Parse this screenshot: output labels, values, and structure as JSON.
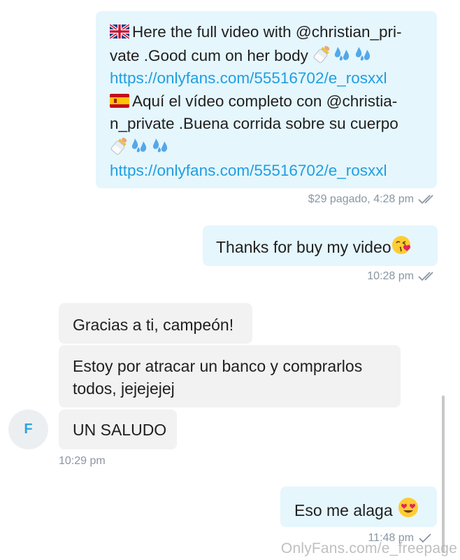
{
  "messages": {
    "m1": {
      "line1": "Here the full video with @christian_pri-",
      "line2": "vate .Good cum on her body",
      "line3": "https://onlyfans.com/55516702/e_rosxxl",
      "line4": "Aquí el vídeo completo con @christia-",
      "line5": "n_private .Buena corrida sobre su cuerpo",
      "line7": "https://onlyfans.com/55516702/e_rosxxl",
      "meta": "$29 pagado, 4:28 pm",
      "flag_en": "uk-flag-icon",
      "flag_es": "spain-flag-icon"
    },
    "m2": {
      "text": "Thanks for buy my video",
      "meta": "10:28 pm",
      "emoji": "kissing-heart-emoji-icon"
    },
    "m3": {
      "text": "Gracias a ti, campeón!"
    },
    "m4": {
      "line1": "Estoy por atracar un banco y comprarlos",
      "line2": "todos, jejejejej"
    },
    "m5": {
      "text": "UN SALUDO",
      "meta": "10:29 pm"
    },
    "m6": {
      "text": "Eso me alaga",
      "meta": "11:48 pm",
      "emoji": "heart-eyes-emoji-icon"
    }
  },
  "avatar": {
    "initial": "F"
  },
  "watermark": "OnlyFans.com/e_freepage",
  "colors": {
    "outgoing_bubble": "#e5f6fd",
    "incoming_bubble": "#f2f2f2",
    "link": "#1f9fe0",
    "meta": "#8a96a3",
    "avatar_letter": "#2aa5e0"
  }
}
